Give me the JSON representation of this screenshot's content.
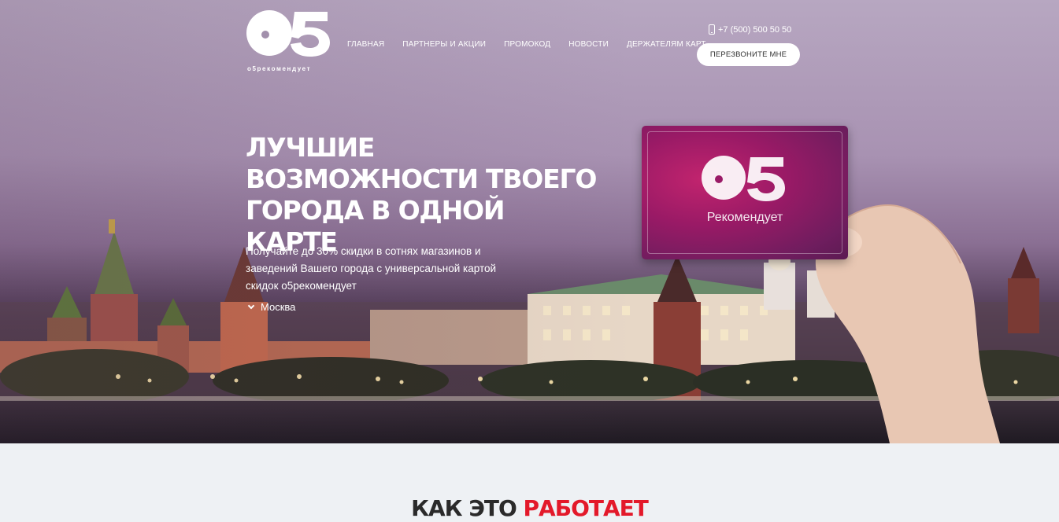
{
  "logo": {
    "mark": "O5",
    "subtitle": "o5рекомендует"
  },
  "nav": {
    "items": [
      "Главная",
      "Партнеры и акции",
      "Промокод",
      "Новости",
      "Держателям карт"
    ]
  },
  "contact": {
    "phone": "+7 (500) 500 50 50",
    "callback_label": "Перезвоните мне"
  },
  "hero": {
    "headline": "Лучшие возможности твоего города в одной карте",
    "lead": "Получайте до 30% скидки в сотнях магазинов и заведений Вашего города с универсальной картой скидок o5рекомендует",
    "city": "Москва"
  },
  "card": {
    "mark": "O5",
    "text": "Рекомендует"
  },
  "section": {
    "title_part1": "Как это",
    "title_part2": "работает"
  },
  "colors": {
    "accent": "#e3192a",
    "card": "#9a1a66"
  }
}
